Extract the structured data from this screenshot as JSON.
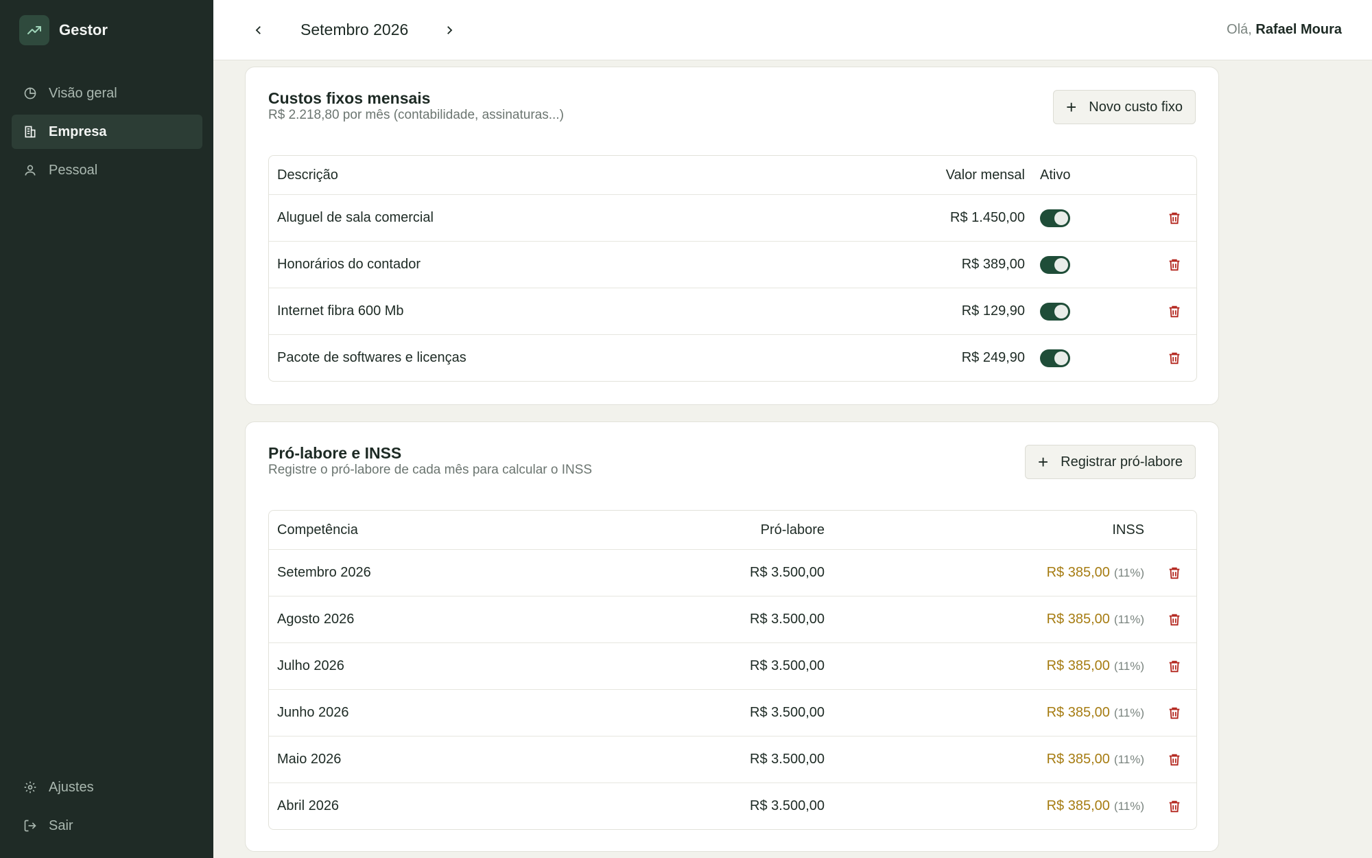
{
  "app": {
    "name": "Gestor"
  },
  "sidebar": {
    "items": [
      {
        "label": "Visão geral",
        "icon": "pie-chart-icon",
        "active": false
      },
      {
        "label": "Empresa",
        "icon": "building-icon",
        "active": true
      },
      {
        "label": "Pessoal",
        "icon": "user-icon",
        "active": false
      }
    ],
    "bottom": [
      {
        "label": "Ajustes",
        "icon": "gear-icon"
      },
      {
        "label": "Sair",
        "icon": "logout-icon"
      }
    ]
  },
  "header": {
    "month": "Setembro 2026",
    "greeting_prefix": "Olá,",
    "user": "Rafael Moura"
  },
  "fixed_costs": {
    "title": "Custos fixos mensais",
    "subtitle": "R$ 2.218,80 por mês (contabilidade, assinaturas...)",
    "button": "Novo custo fixo",
    "columns": {
      "desc": "Descrição",
      "value": "Valor mensal",
      "active": "Ativo"
    },
    "rows": [
      {
        "desc": "Aluguel de sala comercial",
        "value": "R$ 1.450,00",
        "active": true
      },
      {
        "desc": "Honorários do contador",
        "value": "R$ 389,00",
        "active": true
      },
      {
        "desc": "Internet fibra 600 Mb",
        "value": "R$ 129,90",
        "active": true
      },
      {
        "desc": "Pacote de softwares e licenças",
        "value": "R$ 249,90",
        "active": true
      }
    ]
  },
  "prolabore": {
    "title": "Pró-labore e INSS",
    "subtitle": "Registre o pró-labore de cada mês para calcular o INSS",
    "button": "Registrar pró-labore",
    "columns": {
      "comp": "Competência",
      "pro": "Pró-labore",
      "inss": "INSS"
    },
    "rows": [
      {
        "comp": "Setembro 2026",
        "pro": "R$ 3.500,00",
        "inss": "R$ 385,00",
        "pct": "(11%)"
      },
      {
        "comp": "Agosto 2026",
        "pro": "R$ 3.500,00",
        "inss": "R$ 385,00",
        "pct": "(11%)"
      },
      {
        "comp": "Julho 2026",
        "pro": "R$ 3.500,00",
        "inss": "R$ 385,00",
        "pct": "(11%)"
      },
      {
        "comp": "Junho 2026",
        "pro": "R$ 3.500,00",
        "inss": "R$ 385,00",
        "pct": "(11%)"
      },
      {
        "comp": "Maio 2026",
        "pro": "R$ 3.500,00",
        "inss": "R$ 385,00",
        "pct": "(11%)"
      },
      {
        "comp": "Abril 2026",
        "pro": "R$ 3.500,00",
        "inss": "R$ 385,00",
        "pct": "(11%)"
      }
    ]
  },
  "colors": {
    "sidebar_bg": "#1f2b26",
    "toggle_on": "#1f4d38",
    "delete": "#b3261e",
    "inss": "#a67c12"
  }
}
